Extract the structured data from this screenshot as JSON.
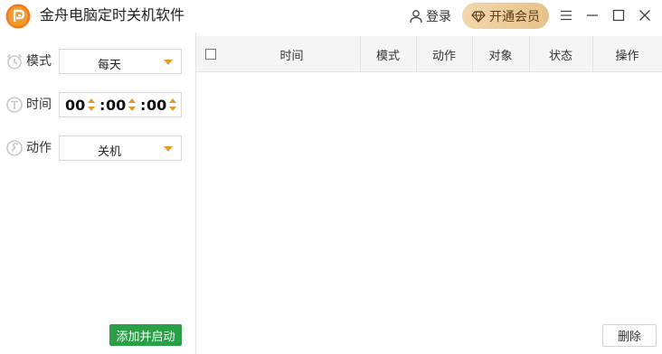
{
  "app": {
    "title": "金舟电脑定时关机软件"
  },
  "header": {
    "login_label": "登录",
    "vip_label": "开通会员"
  },
  "colors": {
    "accent": "#e39a2b",
    "primary_button": "#2aa046",
    "vip_gradient_start": "#f3d7ab",
    "vip_gradient_end": "#e8c28b"
  },
  "form": {
    "mode": {
      "label": "模式",
      "value": "每天"
    },
    "time": {
      "label": "时间",
      "hour": "00",
      "minute": "00",
      "second": "00",
      "separator": ":"
    },
    "action": {
      "label": "动作",
      "value": "关机"
    },
    "add_button": "添加并启动"
  },
  "table": {
    "columns": [
      "时间",
      "模式",
      "动作",
      "对象",
      "状态",
      "操作"
    ],
    "rows": [],
    "delete_button": "删除"
  },
  "icons": {
    "logo": "app-logo-icon",
    "login": "user-icon",
    "vip": "diamond-icon",
    "menu": "menu-icon",
    "minimize": "minimize-icon",
    "maximize": "maximize-icon",
    "close": "close-icon",
    "mode": "alarm-clock-icon",
    "time": "clock-icon",
    "action": "wrench-icon"
  }
}
